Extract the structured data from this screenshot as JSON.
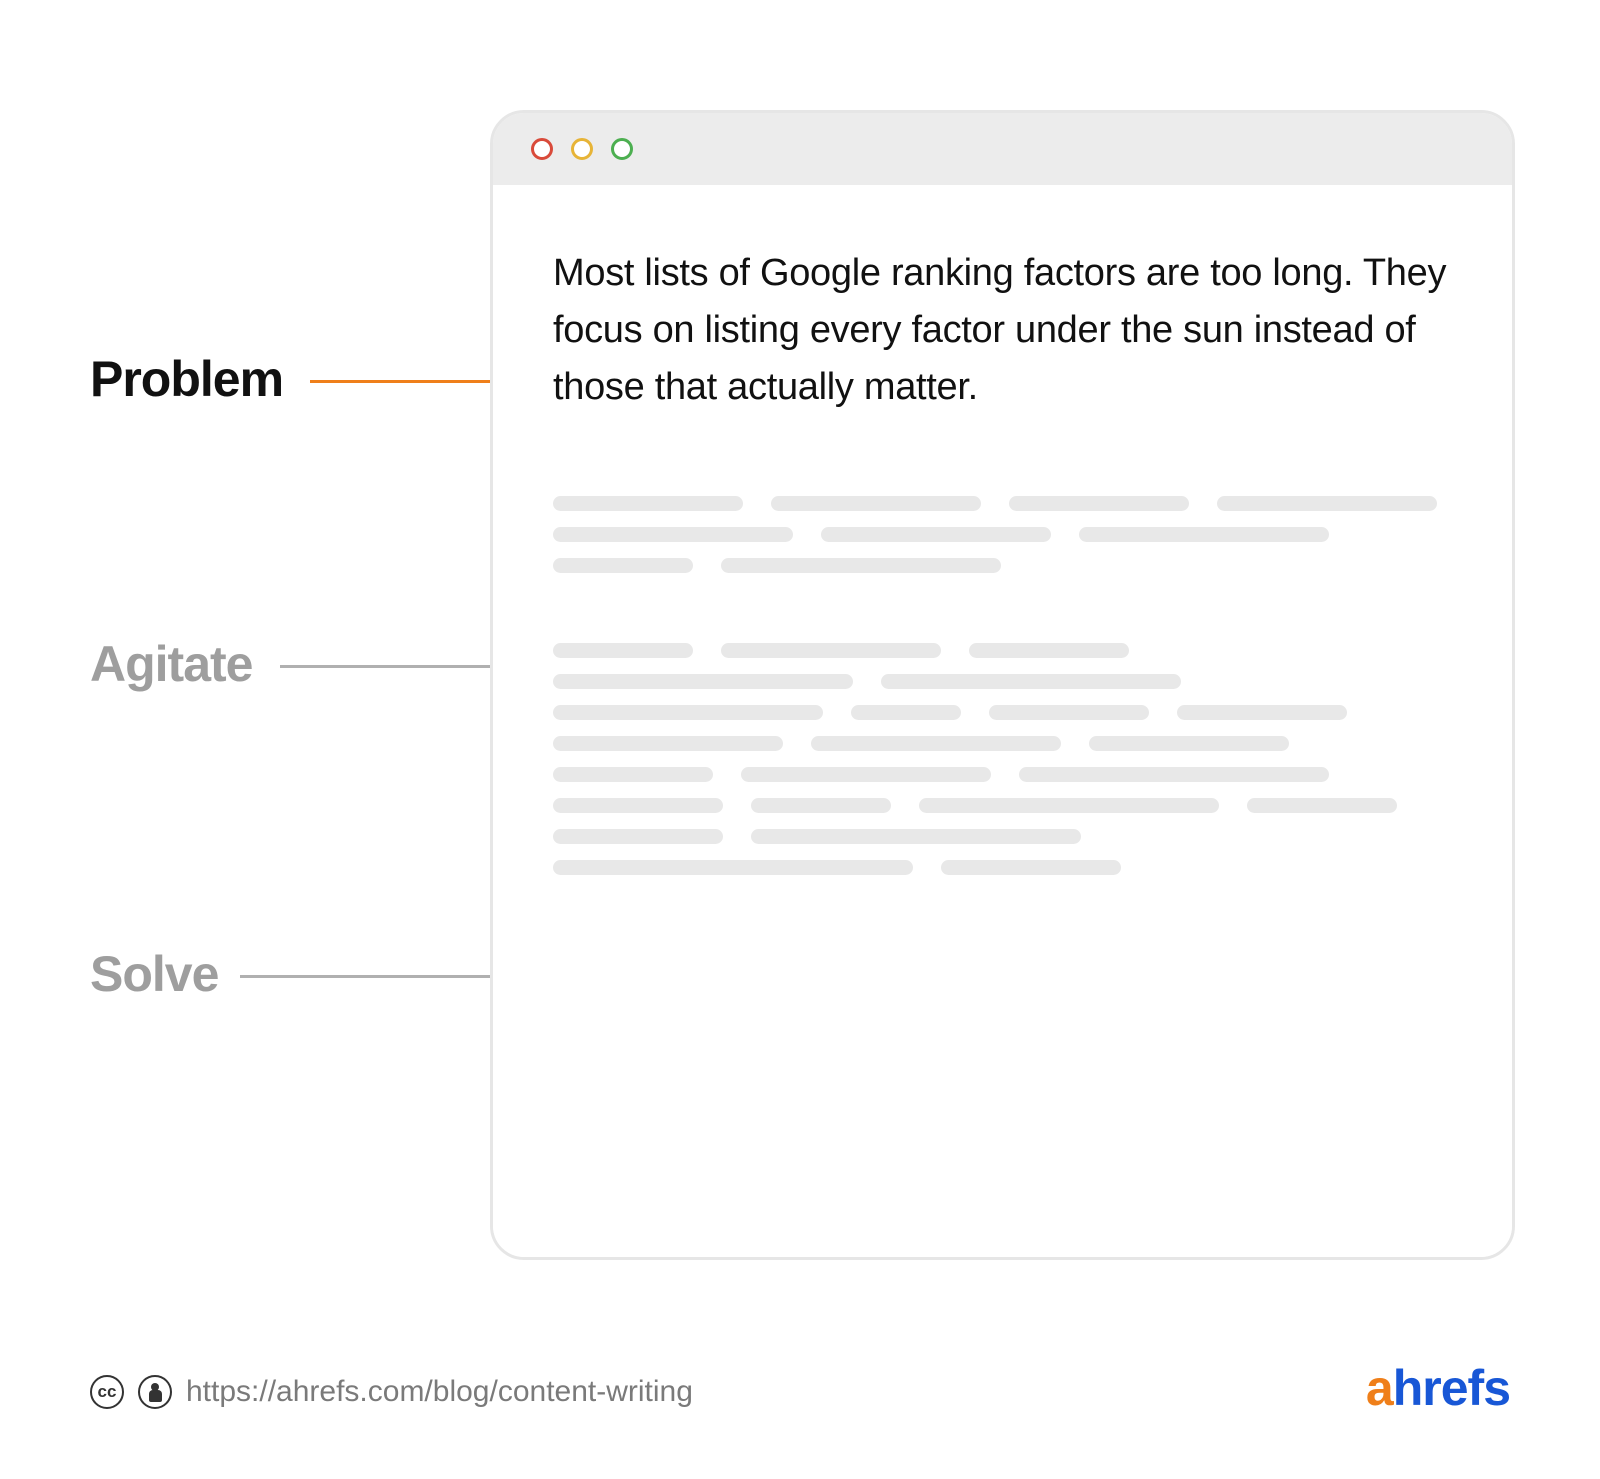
{
  "labels": {
    "problem": "Problem",
    "agitate": "Agitate",
    "solve": "Solve"
  },
  "problem_text": "Most lists of Google ranking factors are too long. They focus on listing every factor under the sun instead of those that actually matter.",
  "footer": {
    "url": "https://ahrefs.com/blog/content-writing"
  },
  "brand": {
    "first": "a",
    "rest": "hrefs"
  },
  "colors": {
    "accent": "#ef7f1a",
    "brand_blue": "#1857d6",
    "muted": "#9e9e9e",
    "placeholder": "#e8e8e8"
  }
}
